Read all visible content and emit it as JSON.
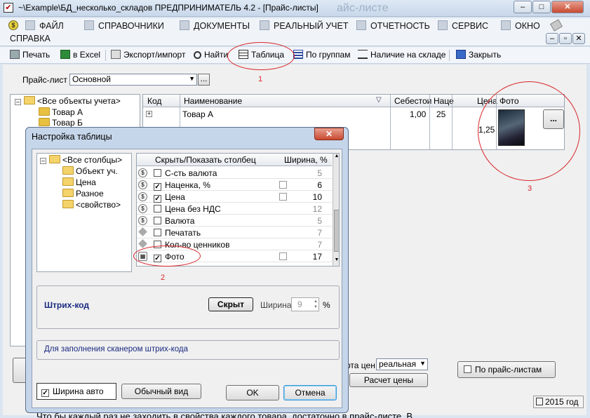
{
  "window": {
    "title": "~\\Example\\БД_несколько_складов  ПРЕДПРИНИМАТЕЛЬ 4.2 - [Прайс-листы]",
    "ghost_title": "айс-листе"
  },
  "menu": {
    "items": [
      "ФАЙЛ",
      "СПРАВОЧНИКИ",
      "ДОКУМЕНТЫ",
      "РЕАЛЬНЫЙ УЧЕТ",
      "ОТЧЕТНОСТЬ",
      "СЕРВИС",
      "ОКНО",
      "СПРАВКА"
    ]
  },
  "toolbar": {
    "print": "Печать",
    "excel": "в Excel",
    "export": "Экспорт/импорт",
    "find": "Найти",
    "table": "Таблица",
    "groups": "По группам",
    "stock": "Наличие на складе",
    "close": "Закрыть"
  },
  "pricelist": {
    "label": "Прайс-лист",
    "value": "Основной"
  },
  "tree": {
    "root": "<Все объекты учета>",
    "items": [
      "Товар А",
      "Товар Б"
    ]
  },
  "grid": {
    "headers": [
      "Код",
      "Наименование",
      "Себестои",
      "Наце",
      "Цена",
      "Фото"
    ],
    "row": {
      "name": "Товар А",
      "cost": "1,00",
      "markup": "25",
      "price": "1,25"
    },
    "photo_btn": "..."
  },
  "annotations": [
    "1",
    "2",
    "3"
  ],
  "dialog": {
    "title": "Настройка таблицы",
    "tree_root": "<Все столбцы>",
    "tree_items": [
      "Объект уч.",
      "Цена",
      "Разное",
      "<свойство>"
    ],
    "col_header": "Скрыть/Показать столбец",
    "width_header": "Ширина, %",
    "rows": [
      {
        "name": "С-сть валюта",
        "checked": false,
        "sub": false,
        "width": "5",
        "icon": "coin"
      },
      {
        "name": "Наценка, %",
        "checked": true,
        "sub": true,
        "width": "6",
        "icon": "coin"
      },
      {
        "name": "Цена",
        "checked": true,
        "sub": true,
        "width": "10",
        "icon": "coin"
      },
      {
        "name": "Цена без НДС",
        "checked": false,
        "sub": false,
        "width": "12",
        "icon": "coin"
      },
      {
        "name": "Валюта",
        "checked": false,
        "sub": false,
        "width": "5",
        "icon": "coin"
      },
      {
        "name": "Печатать",
        "checked": false,
        "sub": false,
        "width": "7",
        "icon": "diamond"
      },
      {
        "name": "Кол-во ценников",
        "checked": false,
        "sub": false,
        "width": "7",
        "icon": "diamond"
      },
      {
        "name": "Фото",
        "checked": true,
        "sub": true,
        "width": "17",
        "icon": "photo"
      }
    ],
    "barcode": {
      "label": "Штрих-код",
      "hidden_btn": "Скрыт",
      "width_label": "Ширина=",
      "width_value": "9",
      "unit": "%"
    },
    "hint": "Для заполнения сканером штрих-кода",
    "auto_width": "Ширина авто",
    "normal_view": "Обычный вид",
    "ok": "OK",
    "cancel": "Отмена"
  },
  "bottom": {
    "price_mode_label": "рта цен",
    "price_mode_value": "реальная",
    "recalc": "Расчет цены",
    "by_pricelists": "По прайс-листам",
    "year": "2015 год",
    "caption": "Что бы каждый раз не заходить в свойства каждого товара, достаточно в прайс-листе. В"
  }
}
